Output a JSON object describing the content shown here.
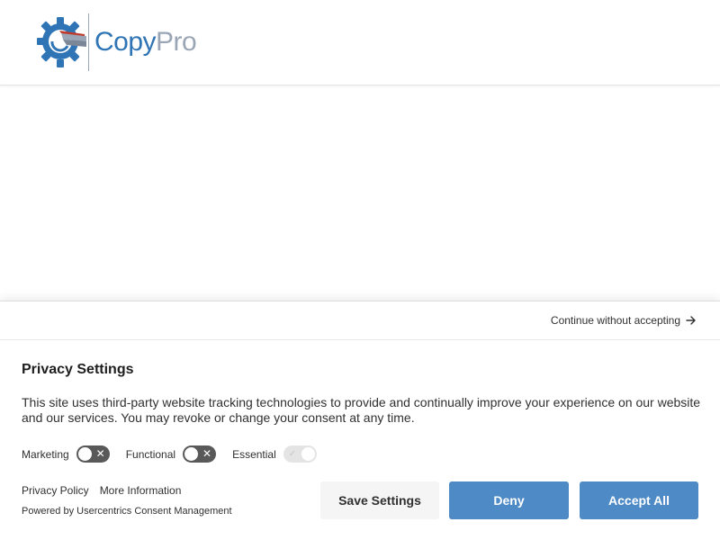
{
  "header": {
    "logo_text_copy": "Copy",
    "logo_text_pro": "Pro",
    "logo_icon": "gear-logo-icon"
  },
  "consent": {
    "continue_label": "Continue without accepting",
    "continue_icon": "arrow-right-icon",
    "title": "Privacy Settings",
    "description": "This site uses third-party website tracking technologies to provide and continually improve your experience on our website and our services. You may revoke or change your consent at any time.",
    "categories": [
      {
        "label": "Marketing",
        "enabled": false,
        "locked": false
      },
      {
        "label": "Functional",
        "enabled": false,
        "locked": false
      },
      {
        "label": "Essential",
        "enabled": true,
        "locked": true
      }
    ],
    "links": {
      "privacy_policy": "Privacy Policy",
      "more_information": "More Information"
    },
    "powered_by": "Powered by Usercentrics Consent Management",
    "buttons": {
      "save": "Save Settings",
      "deny": "Deny",
      "accept": "Accept All"
    }
  },
  "colors": {
    "brand_blue": "#2f74b5",
    "brand_gray": "#9aa5b5",
    "button_blue": "#4e8ac5",
    "toggle_off": "#595959"
  }
}
